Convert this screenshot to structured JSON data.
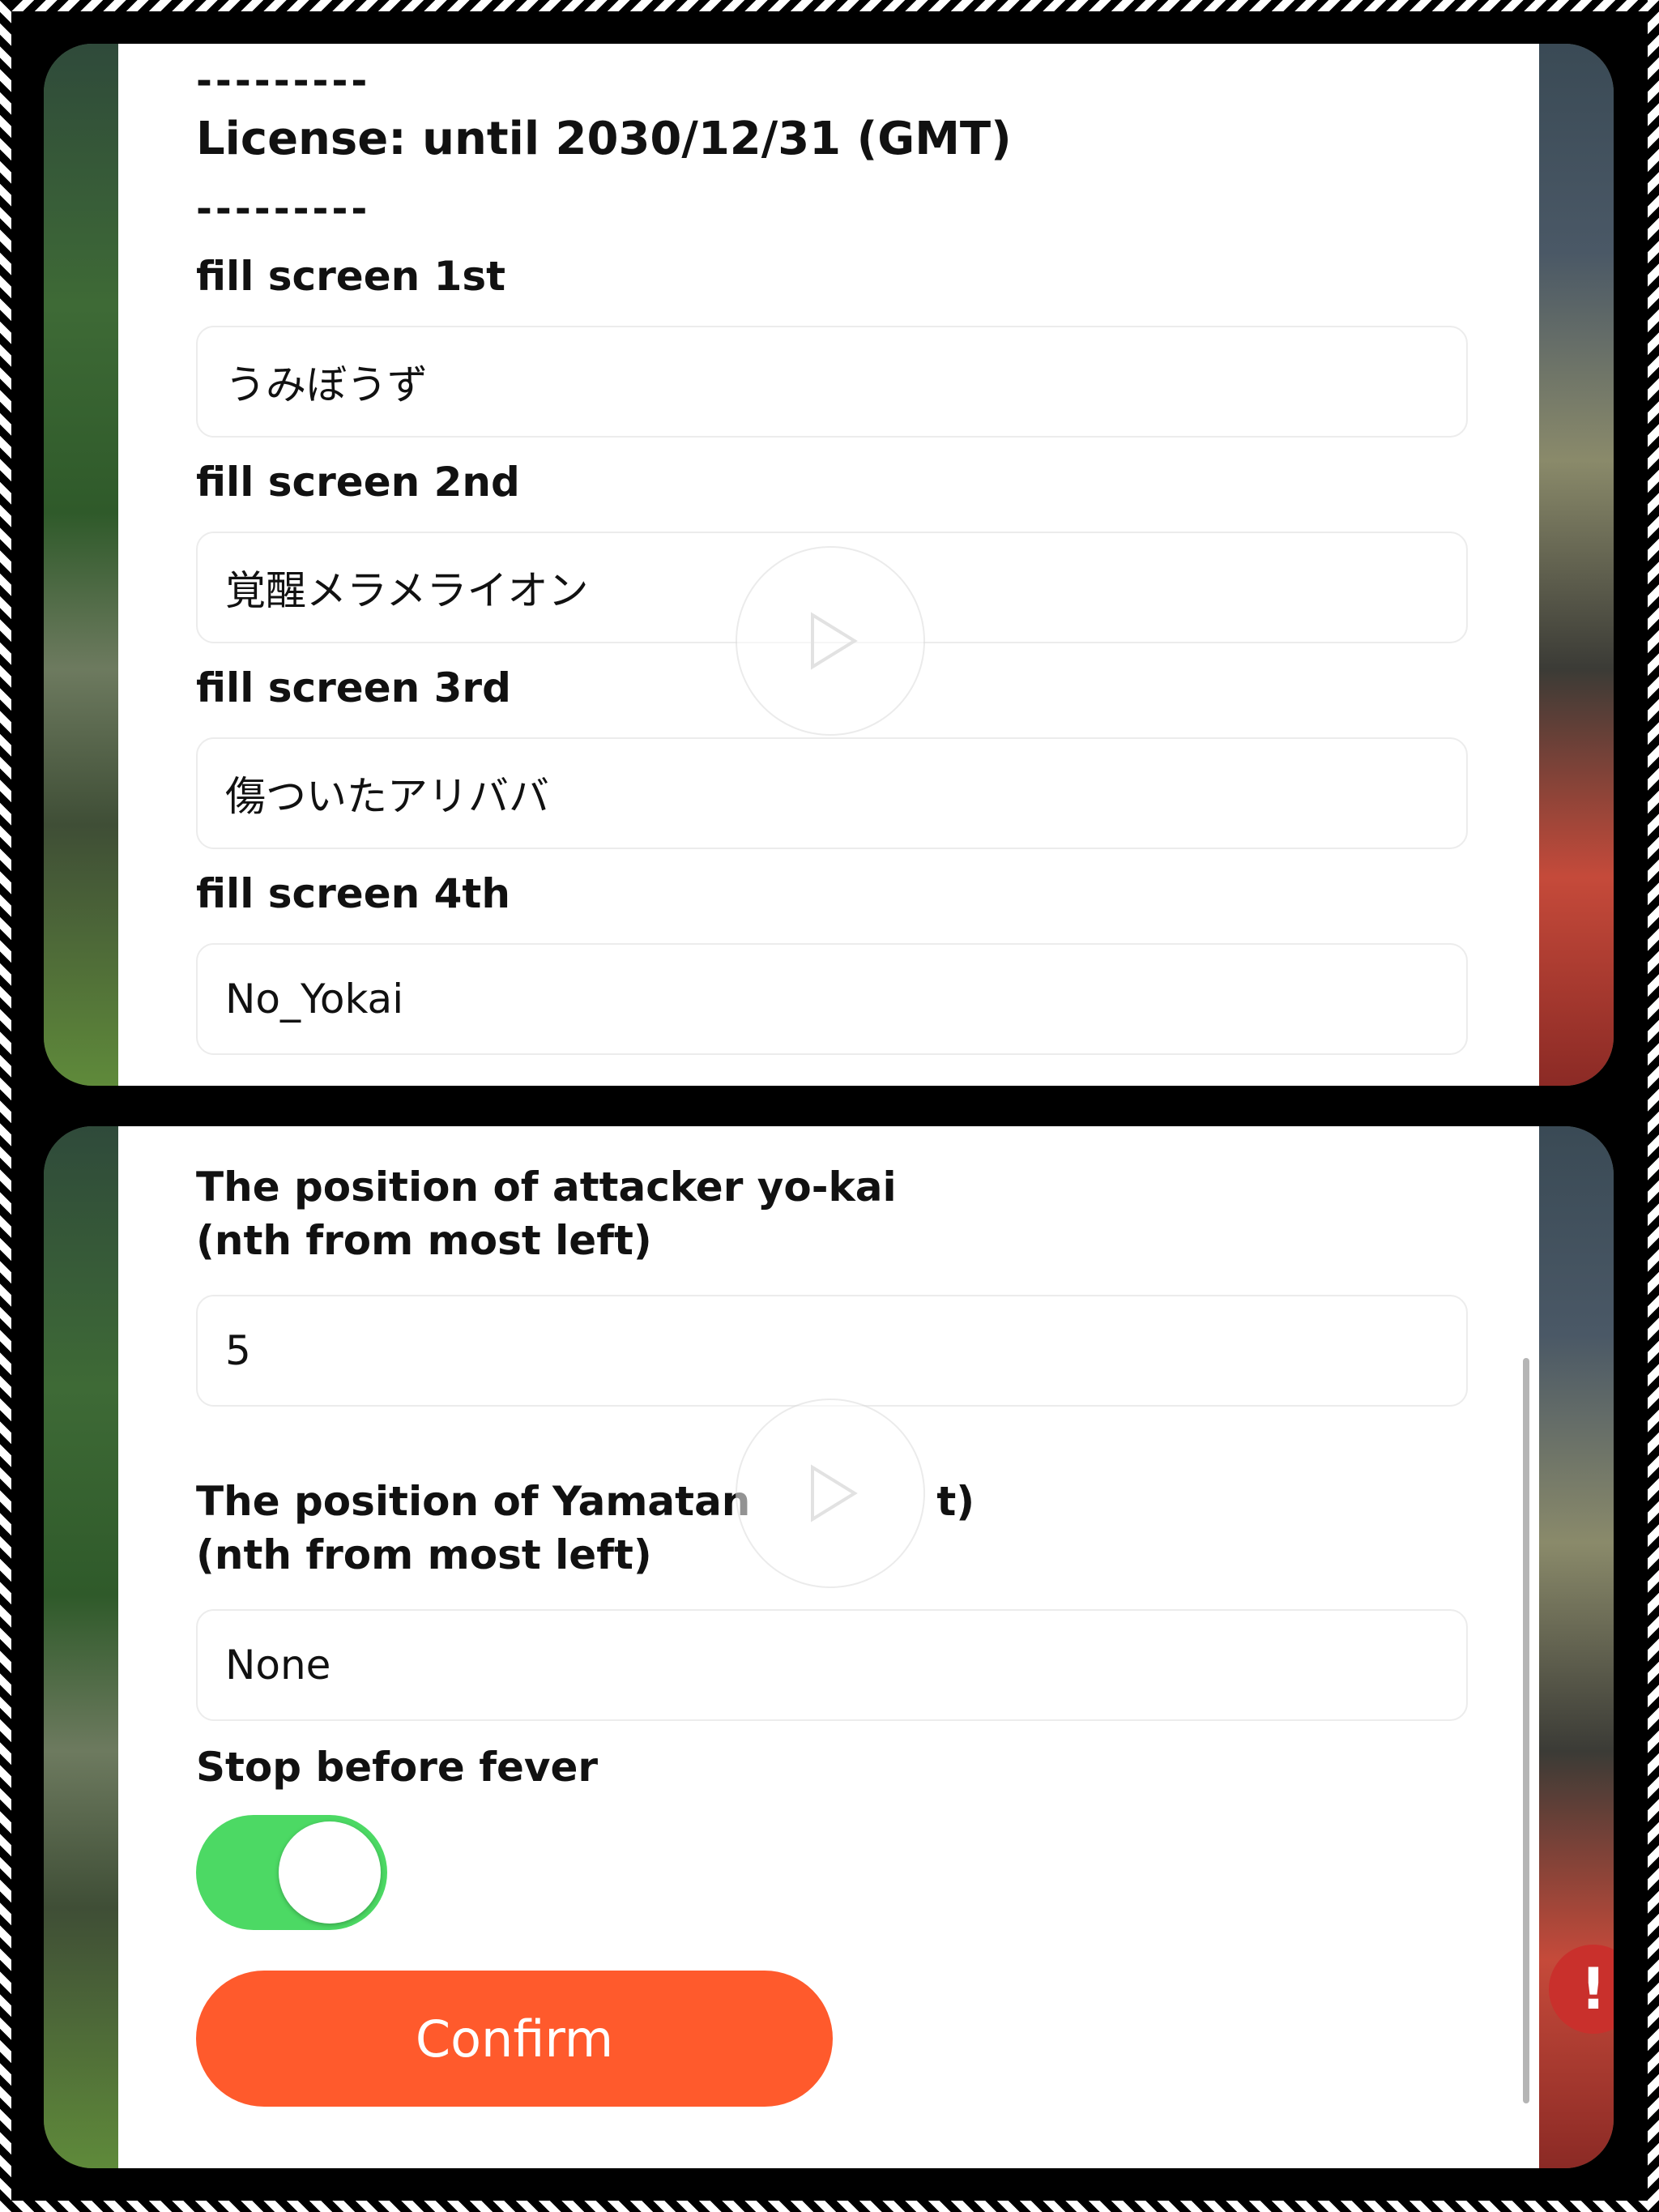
{
  "top_panel": {
    "dash_line_1": "---------",
    "license_text": "License: until 2030/12/31 (GMT)",
    "dash_line_2": "---------",
    "fields": [
      {
        "label": "fill screen 1st",
        "value": "うみぼうず"
      },
      {
        "label": "fill screen 2nd",
        "value": "覚醒メラメライオン"
      },
      {
        "label": "fill screen 3rd",
        "value": "傷ついたアリババ"
      },
      {
        "label": "fill screen 4th",
        "value": "No_Yokai"
      }
    ]
  },
  "bottom_panel": {
    "attacker": {
      "label_line1": "The position of attacker yo-kai",
      "label_line2": "(nth from most left)",
      "value": "5"
    },
    "yamatan": {
      "label_line1_a": "The position of Yamatan",
      "label_line1_b": "t)",
      "label_line2": "(nth from most left)",
      "value": "None"
    },
    "stop_before_fever": {
      "label": "Stop before fever",
      "on": true,
      "color": "#4cd964"
    },
    "confirm_label": "Confirm",
    "confirm_color": "#ff5a2c",
    "alert_badge": "!"
  },
  "icons": [
    "play-icon",
    "toggle-switch",
    "alert-icon"
  ]
}
